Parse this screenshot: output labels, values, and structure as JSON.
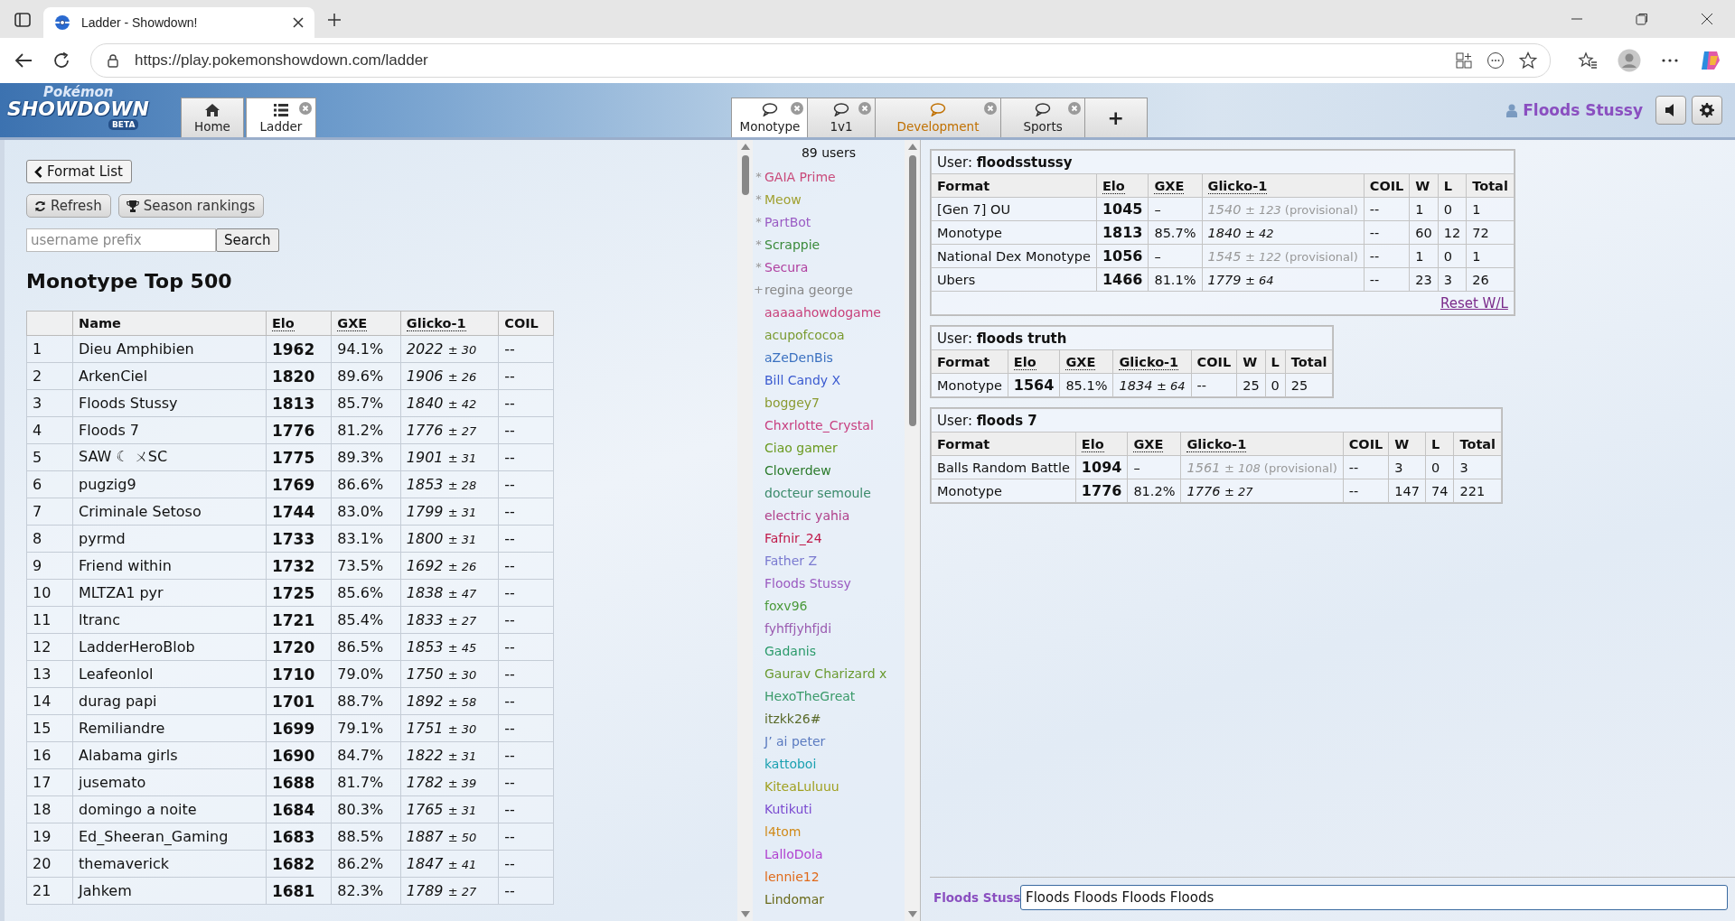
{
  "browser": {
    "tab_title": "Ladder - Showdown!",
    "url": "https://play.pokemonshowdown.com/ladder"
  },
  "header": {
    "logo": {
      "top": "Pokémon",
      "main": "SHOWDOWN",
      "badge": "BETA"
    },
    "main_tabs": [
      {
        "label": "Home",
        "selected": false,
        "closable": false
      },
      {
        "label": "Ladder",
        "selected": true,
        "closable": true
      }
    ],
    "room_tabs": [
      {
        "label": "Monotype",
        "selected": true,
        "notify": false
      },
      {
        "label": "1v1",
        "selected": false,
        "notify": false
      },
      {
        "label": "Development",
        "selected": false,
        "notify": true
      },
      {
        "label": "Sports",
        "selected": false,
        "notify": false
      }
    ],
    "add_tab": "+",
    "user": "Floods Stussy"
  },
  "ladder": {
    "back_button": "Format List",
    "refresh_button": "Refresh",
    "season_button": "Season rankings",
    "search": {
      "placeholder": "username prefix",
      "button": "Search"
    },
    "title": "Monotype Top 500",
    "columns": [
      "Name",
      "Elo",
      "GXE",
      "Glicko-1",
      "COIL"
    ],
    "rows": [
      {
        "rank": "1",
        "name": "Dieu Amphibien",
        "elo": "1962",
        "gxe": "94.1%",
        "glicko": "2022",
        "deviation": "± 30",
        "coil": "--"
      },
      {
        "rank": "2",
        "name": "ArkenCiel",
        "elo": "1820",
        "gxe": "89.6%",
        "glicko": "1906",
        "deviation": "± 26",
        "coil": "--"
      },
      {
        "rank": "3",
        "name": "Floods Stussy",
        "elo": "1813",
        "gxe": "85.7%",
        "glicko": "1840",
        "deviation": "± 42",
        "coil": "--"
      },
      {
        "rank": "4",
        "name": "Floods 7",
        "elo": "1776",
        "gxe": "81.2%",
        "glicko": "1776",
        "deviation": "± 27",
        "coil": "--"
      },
      {
        "rank": "5",
        "name": "SAW ☾ ㄨSC",
        "elo": "1775",
        "gxe": "89.3%",
        "glicko": "1901",
        "deviation": "± 31",
        "coil": "--"
      },
      {
        "rank": "6",
        "name": "pugzig9",
        "elo": "1769",
        "gxe": "86.6%",
        "glicko": "1853",
        "deviation": "± 28",
        "coil": "--"
      },
      {
        "rank": "7",
        "name": "Criminale Setoso",
        "elo": "1744",
        "gxe": "83.0%",
        "glicko": "1799",
        "deviation": "± 31",
        "coil": "--"
      },
      {
        "rank": "8",
        "name": "pyrmd",
        "elo": "1733",
        "gxe": "83.1%",
        "glicko": "1800",
        "deviation": "± 31",
        "coil": "--"
      },
      {
        "rank": "9",
        "name": "Friend within",
        "elo": "1732",
        "gxe": "73.5%",
        "glicko": "1692",
        "deviation": "± 26",
        "coil": "--"
      },
      {
        "rank": "10",
        "name": "MLTZA1 pyr",
        "elo": "1725",
        "gxe": "85.6%",
        "glicko": "1838",
        "deviation": "± 47",
        "coil": "--"
      },
      {
        "rank": "11",
        "name": "ltranc",
        "elo": "1721",
        "gxe": "85.4%",
        "glicko": "1833",
        "deviation": "± 27",
        "coil": "--"
      },
      {
        "rank": "12",
        "name": "LadderHeroBlob",
        "elo": "1720",
        "gxe": "86.5%",
        "glicko": "1853",
        "deviation": "± 45",
        "coil": "--"
      },
      {
        "rank": "13",
        "name": "Leafeonlol",
        "elo": "1710",
        "gxe": "79.0%",
        "glicko": "1750",
        "deviation": "± 30",
        "coil": "--"
      },
      {
        "rank": "14",
        "name": "durag papi",
        "elo": "1701",
        "gxe": "88.7%",
        "glicko": "1892",
        "deviation": "± 58",
        "coil": "--"
      },
      {
        "rank": "15",
        "name": "Remiliandre",
        "elo": "1699",
        "gxe": "79.1%",
        "glicko": "1751",
        "deviation": "± 30",
        "coil": "--"
      },
      {
        "rank": "16",
        "name": "Alabama girls",
        "elo": "1690",
        "gxe": "84.7%",
        "glicko": "1822",
        "deviation": "± 31",
        "coil": "--"
      },
      {
        "rank": "17",
        "name": "jusemato",
        "elo": "1688",
        "gxe": "81.7%",
        "glicko": "1782",
        "deviation": "± 39",
        "coil": "--"
      },
      {
        "rank": "18",
        "name": "domingo a noite",
        "elo": "1684",
        "gxe": "80.3%",
        "glicko": "1765",
        "deviation": "± 31",
        "coil": "--"
      },
      {
        "rank": "19",
        "name": "Ed_Sheeran_Gaming",
        "elo": "1683",
        "gxe": "88.5%",
        "glicko": "1887",
        "deviation": "± 50",
        "coil": "--"
      },
      {
        "rank": "20",
        "name": "themaverick",
        "elo": "1682",
        "gxe": "86.2%",
        "glicko": "1847",
        "deviation": "± 41",
        "coil": "--"
      },
      {
        "rank": "21",
        "name": "Jahkem",
        "elo": "1681",
        "gxe": "82.3%",
        "glicko": "1789",
        "deviation": "± 27",
        "coil": "--"
      }
    ]
  },
  "userlist": {
    "count": "89 users",
    "users": [
      {
        "rank": "*",
        "name": "GAIA Prime",
        "color": "#c94a7a"
      },
      {
        "rank": "*",
        "name": "Meow",
        "color": "#a0a030"
      },
      {
        "rank": "*",
        "name": "PartBot",
        "color": "#9a5bc4"
      },
      {
        "rank": "*",
        "name": "Scrappie",
        "color": "#3a8a3a"
      },
      {
        "rank": "*",
        "name": "Secura",
        "color": "#b040a0"
      },
      {
        "rank": "+",
        "name": "regina george",
        "color": "#888888"
      },
      {
        "name": "aaaaahowdogame",
        "color": "#c8407a"
      },
      {
        "name": "acupofcocoa",
        "color": "#7a9a30"
      },
      {
        "name": "aZeDenBis",
        "color": "#3a70c0"
      },
      {
        "name": "Bill Candy X",
        "color": "#3a5ad0"
      },
      {
        "name": "boggey7",
        "color": "#8a9a30"
      },
      {
        "name": "Chxrlotte_Crystal",
        "color": "#c84080"
      },
      {
        "name": "Ciao gamer",
        "color": "#6a9a20"
      },
      {
        "name": "Cloverdew",
        "color": "#2a7a2a"
      },
      {
        "name": "docteur semoule",
        "color": "#3a8a6a"
      },
      {
        "name": "electric yahia",
        "color": "#b0408a"
      },
      {
        "name": "Fafnir_24",
        "color": "#c01a4a"
      },
      {
        "name": "Father Z",
        "color": "#7a7ad0"
      },
      {
        "name": "Floods Stussy",
        "color": "#9a5ac0"
      },
      {
        "name": "foxv96",
        "color": "#4a9a3a"
      },
      {
        "name": "fyhffjyhfjdi",
        "color": "#9a5ab0"
      },
      {
        "name": "Gadanis",
        "color": "#2a9a6a"
      },
      {
        "name": "Gaurav Charizard x",
        "color": "#6a9a30"
      },
      {
        "name": "HexoTheGreat",
        "color": "#3a9a6a"
      },
      {
        "name": "itzkk26#",
        "color": "#5a6a2a"
      },
      {
        "name": "J’ ai peter",
        "color": "#5a7ac0"
      },
      {
        "name": "kattoboi",
        "color": "#1aa0b0"
      },
      {
        "name": "KiteaLuluuu",
        "color": "#a0a020"
      },
      {
        "name": "Kutikuti",
        "color": "#7a4ad0"
      },
      {
        "name": "l4tom",
        "color": "#d08a1a"
      },
      {
        "name": "LalloDola",
        "color": "#b040d0"
      },
      {
        "name": "lennie12",
        "color": "#e06a1a"
      },
      {
        "name": "Lindomar",
        "color": "#6a6a1a"
      }
    ]
  },
  "stats": [
    {
      "label": "User:",
      "user": "floodsstussy",
      "columns": [
        "Format",
        "Elo",
        "GXE",
        "Glicko-1",
        "COIL",
        "W",
        "L",
        "Total"
      ],
      "link": "Reset W/L",
      "rows": [
        {
          "format": "[Gen 7] OU",
          "elo": "1045",
          "gxe": "–",
          "glicko": "1540",
          "deviation": "± 123",
          "note": "(provisional)",
          "provisional": true,
          "coil": "--",
          "w": "1",
          "l": "0",
          "total": "1"
        },
        {
          "format": "Monotype",
          "elo": "1813",
          "gxe": "85.7%",
          "glicko": "1840",
          "deviation": "± 42",
          "provisional": false,
          "coil": "--",
          "w": "60",
          "l": "12",
          "total": "72"
        },
        {
          "format": "National Dex Monotype",
          "elo": "1056",
          "gxe": "–",
          "glicko": "1545",
          "deviation": "± 122",
          "note": "(provisional)",
          "provisional": true,
          "coil": "--",
          "w": "1",
          "l": "0",
          "total": "1"
        },
        {
          "format": "Ubers",
          "elo": "1466",
          "gxe": "81.1%",
          "glicko": "1779",
          "deviation": "± 64",
          "provisional": false,
          "coil": "--",
          "w": "23",
          "l": "3",
          "total": "26"
        }
      ]
    },
    {
      "label": "User:",
      "user": "floods truth",
      "columns": [
        "Format",
        "Elo",
        "GXE",
        "Glicko-1",
        "COIL",
        "W",
        "L",
        "Total"
      ],
      "rows": [
        {
          "format": "Monotype",
          "elo": "1564",
          "gxe": "85.1%",
          "glicko": "1834",
          "deviation": "± 64",
          "provisional": false,
          "coil": "--",
          "w": "25",
          "l": "0",
          "total": "25"
        }
      ]
    },
    {
      "label": "User:",
      "user": "floods 7",
      "columns": [
        "Format",
        "Elo",
        "GXE",
        "Glicko-1",
        "COIL",
        "W",
        "L",
        "Total"
      ],
      "rows": [
        {
          "format": "Balls Random Battle",
          "elo": "1094",
          "gxe": "–",
          "glicko": "1561",
          "deviation": "± 108",
          "note": "(provisional)",
          "provisional": true,
          "coil": "--",
          "w": "3",
          "l": "0",
          "total": "3"
        },
        {
          "format": "Monotype",
          "elo": "1776",
          "gxe": "81.2%",
          "glicko": "1776",
          "deviation": "± 27",
          "provisional": false,
          "coil": "--",
          "w": "147",
          "l": "74",
          "total": "221"
        }
      ]
    }
  ],
  "chat": {
    "name": "Floods Stuss",
    "value": "Floods Floods Floods Floods"
  }
}
